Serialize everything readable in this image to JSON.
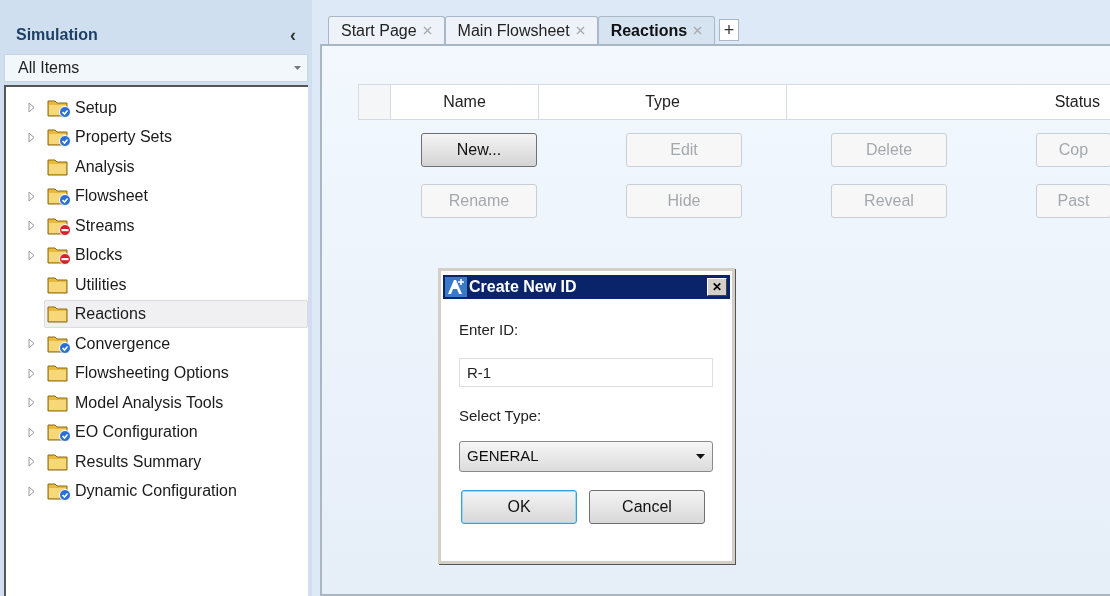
{
  "sidebar": {
    "title": "Simulation",
    "collapse_glyph": "‹",
    "filter": {
      "value": "All Items"
    },
    "tree": [
      {
        "label": "Setup",
        "expandable": true,
        "kind": "ok",
        "selected": false
      },
      {
        "label": "Property Sets",
        "expandable": true,
        "kind": "ok",
        "selected": false
      },
      {
        "label": "Analysis",
        "expandable": false,
        "kind": "plain",
        "selected": false
      },
      {
        "label": "Flowsheet",
        "expandable": true,
        "kind": "ok",
        "selected": false
      },
      {
        "label": "Streams",
        "expandable": true,
        "kind": "error",
        "selected": false
      },
      {
        "label": "Blocks",
        "expandable": true,
        "kind": "error",
        "selected": false
      },
      {
        "label": "Utilities",
        "expandable": false,
        "kind": "plain",
        "selected": false
      },
      {
        "label": "Reactions",
        "expandable": false,
        "kind": "plain",
        "selected": true
      },
      {
        "label": "Convergence",
        "expandable": true,
        "kind": "ok",
        "selected": false
      },
      {
        "label": "Flowsheeting Options",
        "expandable": true,
        "kind": "plain",
        "selected": false
      },
      {
        "label": "Model Analysis Tools",
        "expandable": true,
        "kind": "plain",
        "selected": false
      },
      {
        "label": "EO Configuration",
        "expandable": true,
        "kind": "ok",
        "selected": false
      },
      {
        "label": "Results Summary",
        "expandable": true,
        "kind": "plain",
        "selected": false
      },
      {
        "label": "Dynamic Configuration",
        "expandable": true,
        "kind": "ok",
        "selected": false
      }
    ]
  },
  "tabs": [
    {
      "label": "Start Page",
      "selected": false
    },
    {
      "label": "Main Flowsheet",
      "selected": false
    },
    {
      "label": "Reactions",
      "selected": true
    }
  ],
  "add_tab_glyph": "+",
  "table": {
    "columns": [
      "Name",
      "Type",
      "Status"
    ]
  },
  "buttons": [
    [
      {
        "label": "New...",
        "disabled": false
      },
      {
        "label": "Edit",
        "disabled": true
      },
      {
        "label": "Delete",
        "disabled": true
      },
      {
        "label": "Cop",
        "disabled": true
      }
    ],
    [
      {
        "label": "Rename",
        "disabled": true
      },
      {
        "label": "Hide",
        "disabled": true
      },
      {
        "label": "Reveal",
        "disabled": true
      },
      {
        "label": "Past",
        "disabled": true
      }
    ]
  ],
  "dialog": {
    "title": "Create New ID",
    "close_glyph": "✕",
    "id_label": "Enter ID:",
    "id_value": "R-1",
    "type_label": "Select Type:",
    "type_value": "GENERAL",
    "buttons": [
      {
        "label": "OK",
        "focused": true
      },
      {
        "label": "Cancel",
        "focused": false
      }
    ]
  }
}
